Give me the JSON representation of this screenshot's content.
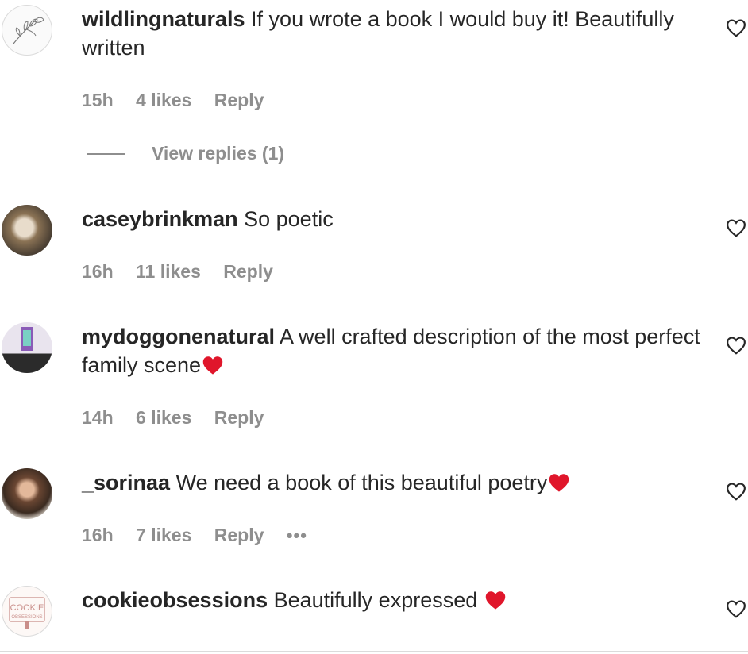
{
  "comments": [
    {
      "username": "wildlingnaturals",
      "text": "If you wrote a book I would buy it! Beautifully written",
      "time": "15h",
      "likes": "4 likes",
      "reply": "Reply",
      "view_replies": "View replies (1)"
    },
    {
      "username": "caseybrinkman",
      "text": "So poetic",
      "time": "16h",
      "likes": "11 likes",
      "reply": "Reply"
    },
    {
      "username": "mydoggonenatural",
      "text": "A well crafted description of the most perfect family scene",
      "time": "14h",
      "likes": "6 likes",
      "reply": "Reply"
    },
    {
      "username": "_sorinaa",
      "text": "We need a book of this beautiful poetry",
      "time": "16h",
      "likes": "7 likes",
      "reply": "Reply",
      "more": "•••"
    },
    {
      "username": "cookieobsessions",
      "text": "Beautifully expressed ",
      "avatar_text_top": "COOKIE",
      "avatar_text_bottom": "OBSESSIONS"
    }
  ],
  "icons": {
    "like": "heart-outline-icon",
    "emoji": "red-heart-emoji"
  },
  "colors": {
    "text": "#262626",
    "secondary": "#8e8e8e",
    "emoji_heart": "#e0162b"
  }
}
